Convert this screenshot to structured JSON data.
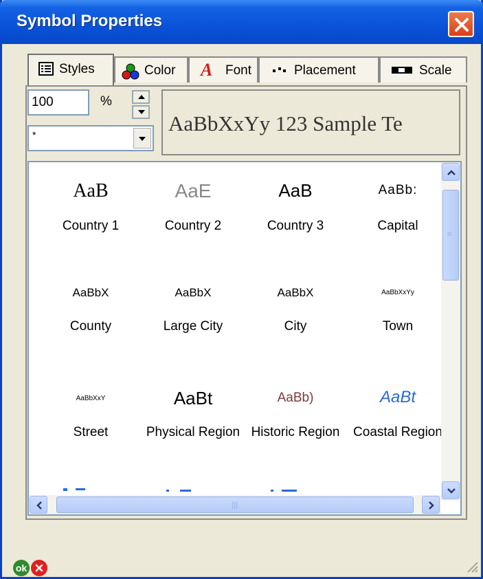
{
  "window": {
    "title": "Symbol Properties"
  },
  "tabs": [
    {
      "label": "Styles",
      "icon": "list-icon",
      "active": true
    },
    {
      "label": "Color",
      "icon": "color-circles-icon",
      "active": false
    },
    {
      "label": "Font",
      "icon": "font-a-icon",
      "active": false
    },
    {
      "label": "Placement",
      "icon": "placement-dots-icon",
      "active": false
    },
    {
      "label": "Scale",
      "icon": "scale-bar-icon",
      "active": false
    }
  ],
  "controls": {
    "size_value": "100",
    "size_unit": "%",
    "style_select_value": "*"
  },
  "preview": {
    "text": "AaBbXxYy 123 Sample Te"
  },
  "styles": [
    {
      "sample": "AaB",
      "name": "Country 1",
      "color": "#333333"
    },
    {
      "sample": "AaE",
      "name": "Country 2",
      "color": "#888888"
    },
    {
      "sample": "AaB",
      "name": "Country 3",
      "color": "#000000"
    },
    {
      "sample": "AaBb:",
      "name": "Capital",
      "color": "#000000"
    },
    {
      "sample": "AaBbX",
      "name": "County",
      "color": "#000000"
    },
    {
      "sample": "AaBbX",
      "name": "Large City",
      "color": "#000000"
    },
    {
      "sample": "AaBbX",
      "name": "City",
      "color": "#000000"
    },
    {
      "sample": "AaBbXxYy",
      "name": "Town",
      "color": "#000000"
    },
    {
      "sample": "AaBbXxY",
      "name": "Street",
      "color": "#000000"
    },
    {
      "sample": "AaBt",
      "name": "Physical Region",
      "color": "#000000"
    },
    {
      "sample": "AaBb)",
      "name": "Historic Region",
      "color": "#7a3a3a"
    },
    {
      "sample": "AaBt",
      "name": "Coastal Region",
      "color": "#2a6ad8"
    }
  ],
  "footer": {
    "ok_label": "ok"
  },
  "colors": {
    "title_bar": "#0a52d8",
    "dialog_bg": "#ece9d8",
    "coastal_blue": "#2a6ad8",
    "historic_brown": "#7a3a3a"
  }
}
